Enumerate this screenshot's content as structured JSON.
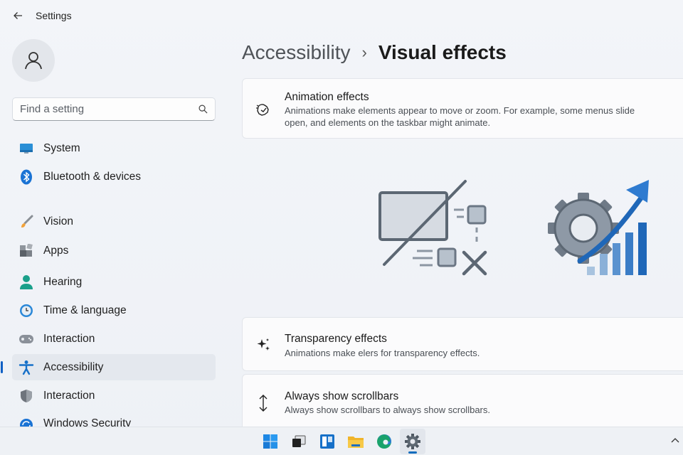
{
  "app": {
    "title": "Settings"
  },
  "search": {
    "placeholder": "Find a setting"
  },
  "sidebar": {
    "items": [
      {
        "label": "System",
        "icon": "monitor-icon"
      },
      {
        "label": "Bluetooth & devices",
        "icon": "bluetooth-icon"
      },
      {
        "label": "Vision",
        "icon": "brush-icon"
      },
      {
        "label": "Apps",
        "icon": "apps-icon"
      },
      {
        "label": "Hearing",
        "icon": "person-icon"
      },
      {
        "label": "Time & language",
        "icon": "clock-globe-icon"
      },
      {
        "label": "Interaction",
        "icon": "gamepad-icon"
      },
      {
        "label": "Accessibility",
        "icon": "accessibility-icon",
        "active": true
      },
      {
        "label": "Interaction",
        "icon": "shield-icon"
      },
      {
        "label": "Windows Security",
        "icon": "update-icon"
      }
    ]
  },
  "breadcrumb": {
    "parent": "Accessibility",
    "separator": "›",
    "current": "Visual effects"
  },
  "cards": [
    {
      "title": "Animation effects",
      "description": "Animations make elements appear to move or zoom. For example, some menus slide open, and elements on the taskbar might animate.",
      "icon": "animation-icon"
    },
    {
      "title": "Transparency effects",
      "description": "Animations make elers for transparency effects.",
      "icon": "sparkle-icon"
    },
    {
      "title": "Always show scrollbars",
      "description": "Always show scrollbars to always show scrollbars.",
      "icon": "vertical-arrows-icon"
    }
  ],
  "taskbar": {
    "icons": [
      "windows-start-icon",
      "task-view-icon",
      "widgets-icon",
      "file-explorer-icon",
      "edge-browser-icon",
      "settings-gear-icon"
    ],
    "active": "settings-gear-icon"
  },
  "colors": {
    "accent": "#0f6cbd",
    "background": "#f3f5f9",
    "card": "#fbfbfc"
  }
}
